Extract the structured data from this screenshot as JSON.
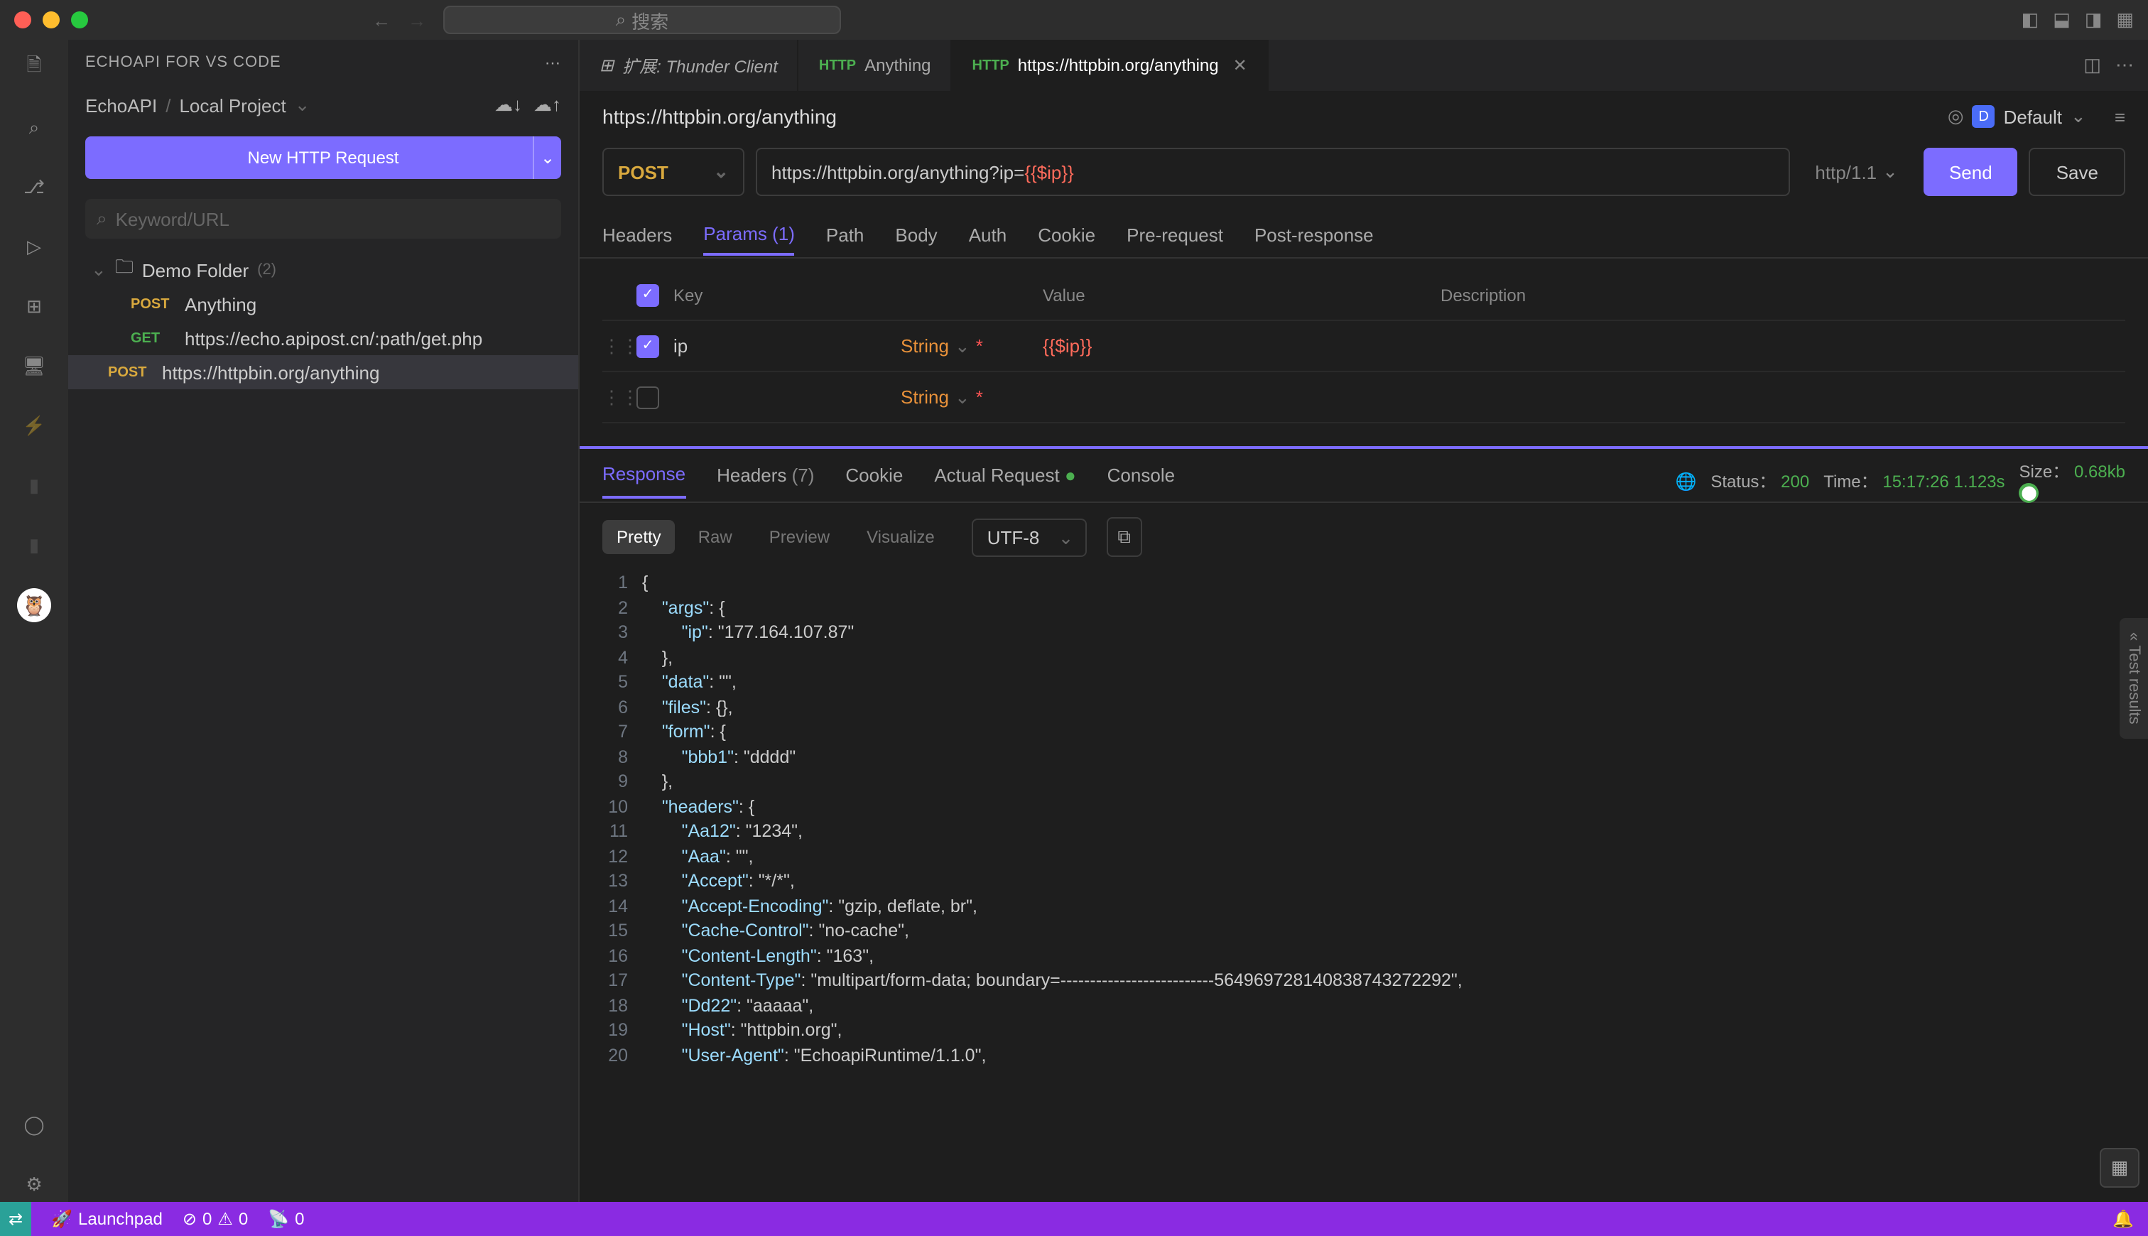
{
  "titlebar": {
    "search_placeholder": "搜索"
  },
  "sidebar": {
    "title": "ECHOAPI FOR VS CODE",
    "breadcrumb_root": "EchoAPI",
    "breadcrumb_sep": "/",
    "breadcrumb_project": "Local Project",
    "new_request": "New HTTP Request",
    "search_placeholder": "Keyword/URL",
    "folder_name": "Demo Folder",
    "folder_count": "(2)",
    "items": [
      {
        "method": "POST",
        "name": "Anything"
      },
      {
        "method": "GET",
        "name": "https://echo.apipost.cn/:path/get.php"
      },
      {
        "method": "POST",
        "name": "https://httpbin.org/anything"
      }
    ]
  },
  "tabs": [
    {
      "label": "扩展: Thunder Client",
      "italic": true,
      "icon": "ext"
    },
    {
      "label": "Anything",
      "icon": "http"
    },
    {
      "label": "https://httpbin.org/anything",
      "icon": "http",
      "active": true,
      "close": true
    }
  ],
  "request": {
    "name": "https://httpbin.org/anything",
    "env_label": "Default",
    "env_badge": "D",
    "method": "POST",
    "url_plain": "https://httpbin.org/anything?ip=",
    "url_var": "{{$ip}}",
    "protocol": "http/1.1",
    "send": "Send",
    "save": "Save",
    "tabs": [
      "Headers",
      "Params",
      "Path",
      "Body",
      "Auth",
      "Cookie",
      "Pre-request",
      "Post-response"
    ],
    "params_count": "(1)",
    "param_headers": {
      "key": "Key",
      "value": "Value",
      "desc": "Description"
    },
    "params": [
      {
        "checked": true,
        "key": "ip",
        "type": "String",
        "required": true,
        "value": "{{$ip}}"
      },
      {
        "checked": false,
        "key": "",
        "type": "String",
        "required": true,
        "value": ""
      }
    ]
  },
  "response": {
    "tabs": [
      "Response",
      "Headers",
      "Cookie",
      "Actual Request",
      "Console"
    ],
    "headers_count": "(7)",
    "status_label": "Status：",
    "status": "200",
    "time_label": "Time：",
    "time": "15:17:26",
    "duration": "1.123s",
    "size_label": "Size：",
    "size": "0.68kb",
    "views": [
      "Pretty",
      "Raw",
      "Preview",
      "Visualize"
    ],
    "encoding": "UTF-8",
    "lines": [
      "{",
      "    \"args\": {",
      "        \"ip\": \"177.164.107.87\"",
      "    },",
      "    \"data\": \"\",",
      "    \"files\": {},",
      "    \"form\": {",
      "        \"bbb1\": \"dddd\"",
      "    },",
      "    \"headers\": {",
      "        \"Aa12\": \"1234\",",
      "        \"Aaa\": \"\",",
      "        \"Accept\": \"*/*\",",
      "        \"Accept-Encoding\": \"gzip, deflate, br\",",
      "        \"Cache-Control\": \"no-cache\",",
      "        \"Content-Length\": \"163\",",
      "        \"Content-Type\": \"multipart/form-data; boundary=--------------------------564969728140838743272292\",",
      "        \"Dd22\": \"aaaaa\",",
      "        \"Host\": \"httpbin.org\",",
      "        \"User-Agent\": \"EchoapiRuntime/1.1.0\","
    ]
  },
  "statusbar": {
    "launchpad": "Launchpad",
    "errors": "0",
    "warnings": "0",
    "ports": "0"
  },
  "testresults_label": "Test results"
}
